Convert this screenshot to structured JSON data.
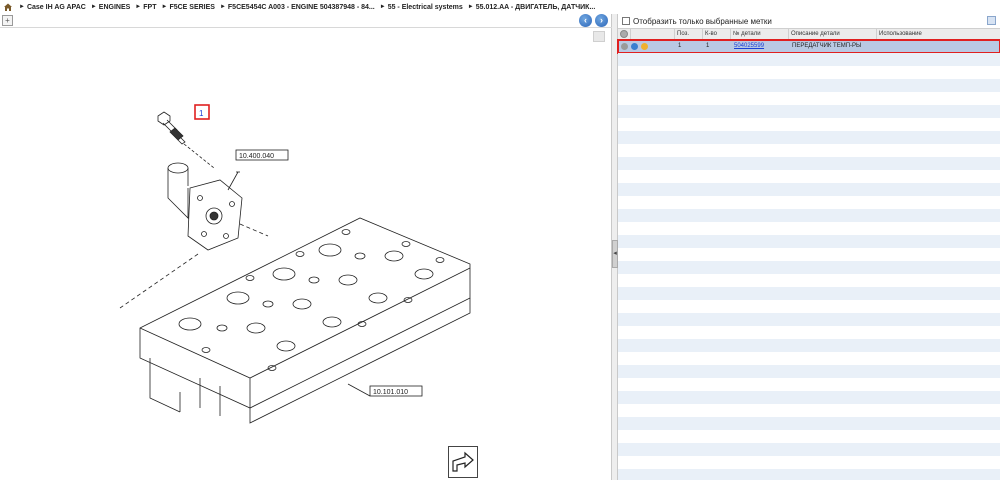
{
  "breadcrumb": {
    "items": [
      "Case IH AG APAC",
      "ENGINES",
      "FPT",
      "F5CE SERIES",
      "F5CE5454C A003 - ENGINE 504387948 - 84...",
      "55 - Electrical systems",
      "55.012.AA - ДВИГАТЕЛЬ, ДАТЧИК..."
    ]
  },
  "viewer": {
    "callouts": [
      "10.400.040",
      "10.101.010"
    ],
    "hotspot": "1"
  },
  "parts": {
    "filter_label": "Отобразить только выбранные метки",
    "columns": [
      "Поз.",
      "К-во",
      "№ детали",
      "Описание детали",
      "Использование"
    ],
    "rows": [
      {
        "pos": "1",
        "qty": "1",
        "part_no": "504025599",
        "description": "ПЕРЕДАТЧИК ТЕМП-РЫ",
        "usage": "",
        "selected": true
      }
    ]
  },
  "colors": {
    "selection": "#b9c9e3",
    "highlight_border": "#e02020",
    "link": "#1a3fd6",
    "stripe": "#e9f0f8"
  }
}
